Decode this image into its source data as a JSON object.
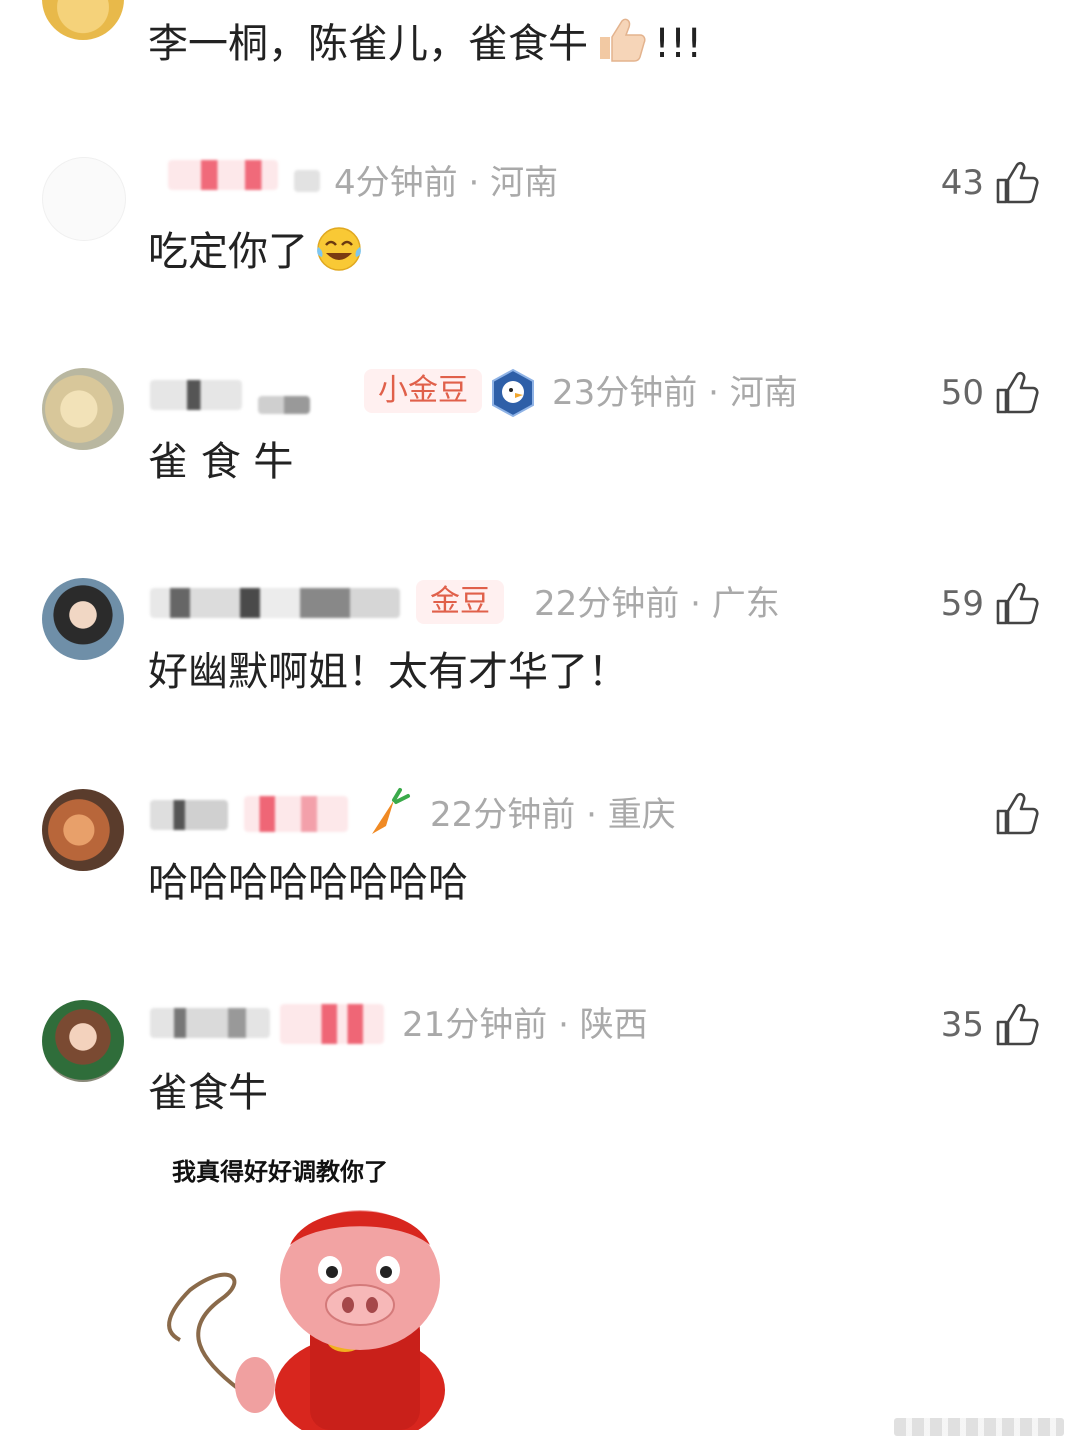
{
  "comments": [
    {
      "text": "李一桐，陈雀儿，雀食牛",
      "suffix": "!!!"
    },
    {
      "time": "4分钟前",
      "location": "河南",
      "text": "吃定你了",
      "likes": "43"
    },
    {
      "badge": "小金豆",
      "time": "23分钟前",
      "location": "河南",
      "text": "雀 食 牛",
      "likes": "50"
    },
    {
      "badge": "金豆",
      "time": "22分钟前",
      "location": "广东",
      "text": "好幽默啊姐！太有才华了！",
      "likes": "59"
    },
    {
      "time": "22分钟前",
      "location": "重庆",
      "text": "哈哈哈哈哈哈哈哈",
      "likes": ""
    },
    {
      "time": "21分钟前",
      "location": "陕西",
      "text": "雀食牛",
      "likes": "35",
      "sticker_caption": "我真得好好调教你了"
    }
  ],
  "separator": " · ",
  "icons": {
    "like": "thumbs-up-icon",
    "emoji_thumbs": "thumbs-up-emoji",
    "emoji_laugh": "tears-of-joy-emoji"
  },
  "colors": {
    "meta": "#a9a9a9",
    "badge_text": "#e0604a",
    "badge_bg": "#fff0f0",
    "text": "#222222"
  }
}
